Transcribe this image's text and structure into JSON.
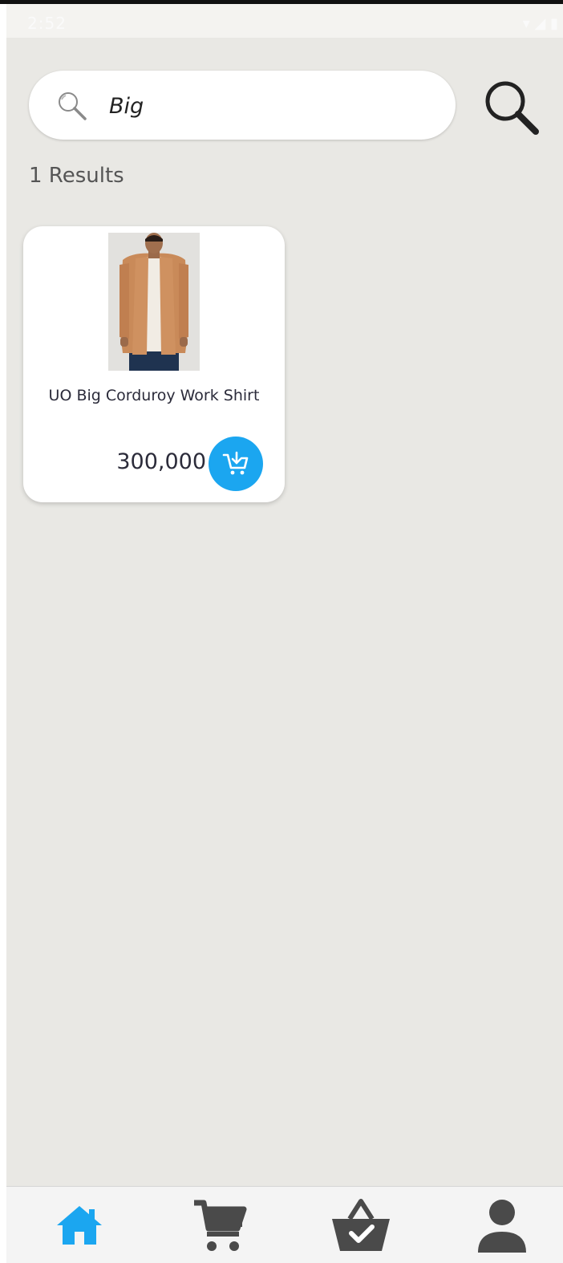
{
  "status_bar": {
    "time": "2:52",
    "icons": [
      "wifi-icon",
      "signal-icon",
      "battery-icon"
    ]
  },
  "search": {
    "value": "Big",
    "placeholder": "",
    "icon": "search-icon",
    "submit_icon": "search-icon"
  },
  "results": {
    "count_label": "1 Results"
  },
  "products": [
    {
      "name": "UO Big Corduroy Work Shirt",
      "price": "300,000",
      "add_icon": "add-to-cart-icon"
    }
  ],
  "bottom_nav": {
    "items": [
      {
        "icon": "home-icon",
        "active": true
      },
      {
        "icon": "cart-icon",
        "active": false
      },
      {
        "icon": "basket-check-icon",
        "active": false
      },
      {
        "icon": "profile-icon",
        "active": false
      }
    ]
  },
  "colors": {
    "accent": "#1ba6f0",
    "background": "#e9e8e4",
    "nav_inactive": "#4a4a4a"
  }
}
